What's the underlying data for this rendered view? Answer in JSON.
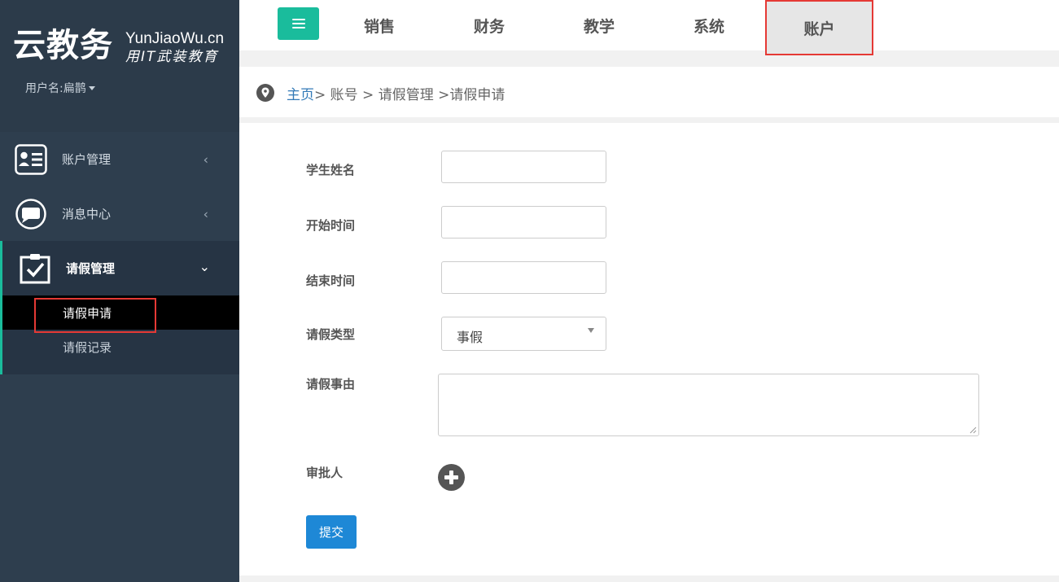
{
  "brand": {
    "logo_cn": "云教务",
    "logo_en": "YunJiaoWu.cn",
    "slogan": "用IT武装教育",
    "username": "用户名:扁鹊"
  },
  "sidebar": {
    "items": [
      {
        "label": "账户管理",
        "chevron": "‹",
        "icon": "contact-card-icon"
      },
      {
        "label": "消息中心",
        "chevron": "‹",
        "icon": "message-bubble-icon"
      }
    ],
    "group": {
      "label": "请假管理",
      "chevron": "⌄",
      "icon": "clipboard-check-icon",
      "sub_items": [
        {
          "label": "请假申请",
          "active": true
        },
        {
          "label": "请假记录",
          "active": false
        }
      ]
    }
  },
  "topnav": {
    "tabs": [
      {
        "label": "销售",
        "active": false
      },
      {
        "label": "财务",
        "active": false
      },
      {
        "label": "教学",
        "active": false
      },
      {
        "label": "系统",
        "active": false
      },
      {
        "label": "账户",
        "active": true
      }
    ]
  },
  "breadcrumb": {
    "home": "主页",
    "rest": "> 账号 > 请假管理 >请假申请"
  },
  "form": {
    "student_name_label": "学生姓名",
    "student_name_value": "",
    "start_time_label": "开始时间",
    "start_time_value": "",
    "end_time_label": "结束时间",
    "end_time_value": "",
    "leave_type_label": "请假类型",
    "leave_type_value": "事假",
    "reason_label": "请假事由",
    "reason_value": "",
    "approver_label": "审批人",
    "submit_label": "提交"
  },
  "colors": {
    "sidebar_bg": "#2e3e4e",
    "accent": "#1abc9c",
    "highlight": "#e53935",
    "primary_button": "#1e88d6",
    "link": "#337ab7"
  }
}
